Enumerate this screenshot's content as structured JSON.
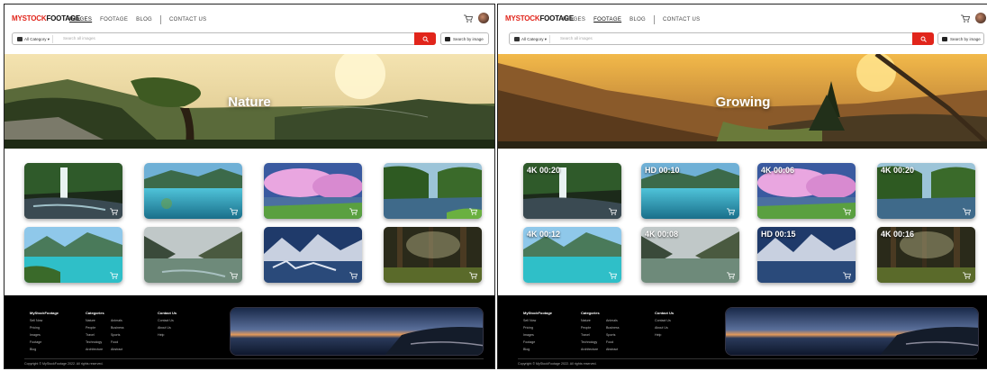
{
  "brand": {
    "my": "MY",
    "stock": "STOCK",
    "footage": "FOOTAGE"
  },
  "nav": {
    "images": "IMAGES",
    "footage": "FOOTAGE",
    "blog": "BLOG",
    "contact": "CONTACT US"
  },
  "search": {
    "category": "All Category",
    "placeholder": "Search all images",
    "image_search": "Search by image"
  },
  "colors": {
    "accent": "#e1251b",
    "footer_bg": "#000000"
  },
  "pages": [
    {
      "active_nav": "images",
      "hero_title": "Nature"
    },
    {
      "active_nav": "footage",
      "hero_title": "Growing",
      "durations": [
        "4K 00:20",
        "HD 00:10",
        "4K 00:06",
        "4K 00:20",
        "4K 00:12",
        "4K 00:08",
        "HD 00:15",
        "4K 00:16"
      ]
    }
  ],
  "footer": {
    "col1": {
      "heading": "MyStockFootage",
      "items": [
        "Sell Now",
        "Pricing",
        "Images",
        "Footage",
        "Blog"
      ]
    },
    "col2": {
      "heading": "Categories",
      "items": [
        "Nature",
        "Animals",
        "People",
        "Business",
        "Travel",
        "Sports",
        "Technology",
        "Food",
        "Architecture",
        "Abstract"
      ]
    },
    "col3": {
      "heading": "Contact Us",
      "items": [
        "Contact Us",
        "About Us",
        "Help"
      ]
    },
    "copyright": "Copyright © MyStockFootage 2022. All rights reserved."
  }
}
